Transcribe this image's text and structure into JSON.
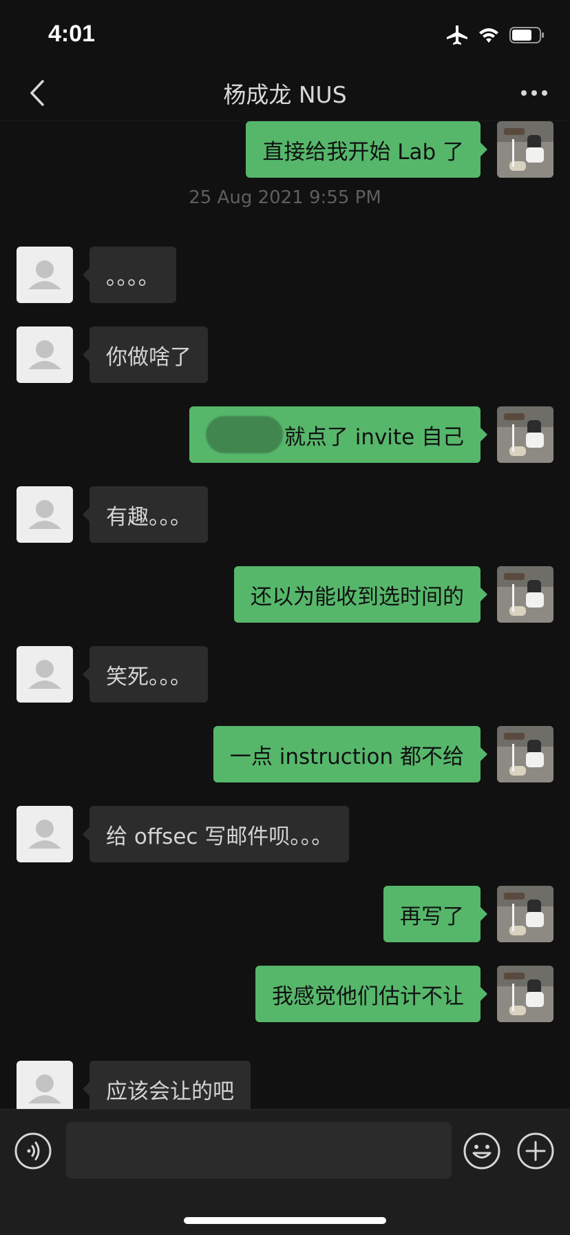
{
  "status_bar": {
    "time": "4:01",
    "icons": [
      "airplane-mode-icon",
      "wifi-icon",
      "battery-icon"
    ]
  },
  "nav": {
    "title": "杨成龙 NUS",
    "back_icon": "chevron-left-icon",
    "more_icon": "more-dots-icon"
  },
  "chat": {
    "timestamp": "25 Aug 2021 9:55 PM",
    "messages": [
      {
        "side": "right",
        "text": "直接给我开始 Lab 了"
      },
      {
        "side": "left",
        "text": "。。。。"
      },
      {
        "side": "left",
        "text": "你做啥了"
      },
      {
        "side": "right",
        "text": "就点了 invite 自己",
        "redacted_prefix": true
      },
      {
        "side": "left",
        "text": "有趣。。。"
      },
      {
        "side": "right",
        "text": "还以为能收到选时间的"
      },
      {
        "side": "left",
        "text": "笑死。。。"
      },
      {
        "side": "right",
        "text": "一点 instruction 都不给"
      },
      {
        "side": "left",
        "text": "给 offsec 写邮件呗。。。"
      },
      {
        "side": "right",
        "text": "再写了"
      },
      {
        "side": "right",
        "text": "我感觉他们估计不让"
      },
      {
        "side": "left",
        "text": "应该会让的吧"
      }
    ]
  },
  "input_bar": {
    "voice_icon": "voice-icon",
    "emoji_icon": "emoji-icon",
    "plus_icon": "plus-circle-icon",
    "text_value": ""
  },
  "colors": {
    "background": "#111111",
    "sent_bubble": "#56b76b",
    "received_bubble": "#2c2c2c",
    "timestamp": "#5f5f5f"
  }
}
